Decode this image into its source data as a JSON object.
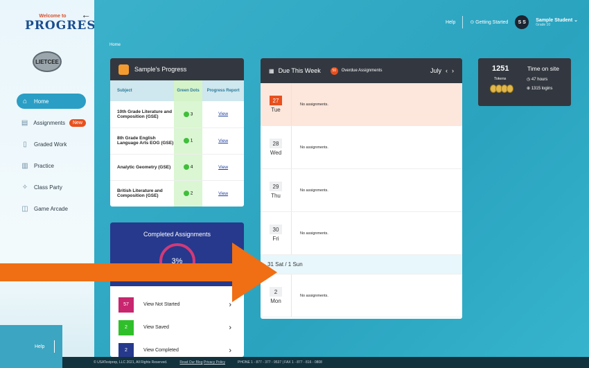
{
  "brand": {
    "welcome": "Welcome to",
    "name": "PROGRESS",
    "school": "LIETCEE"
  },
  "sidebar": {
    "items": [
      {
        "label": "Home",
        "icon": "home-icon"
      },
      {
        "label": "Assignments",
        "icon": "assignment-icon",
        "badge": "New"
      },
      {
        "label": "Graded Work",
        "icon": "document-icon"
      },
      {
        "label": "Practice",
        "icon": "practice-icon"
      },
      {
        "label": "Class Party",
        "icon": "party-icon"
      },
      {
        "label": "Game Arcade",
        "icon": "gamepad-icon"
      }
    ]
  },
  "header": {
    "help": "Help",
    "getting_started": "Getting Started",
    "user_initials": "S S",
    "user_name": "Sample Student",
    "grade": "Grade 10"
  },
  "breadcrumb": "Home",
  "progress": {
    "title": "Sample's Progress",
    "col_subject": "Subject",
    "col_dots": "Green Dots",
    "col_report": "Progress Report",
    "rows": [
      {
        "subject": "10th Grade Literature and Composition (GSE)",
        "dots": "3",
        "report": "View"
      },
      {
        "subject": "8th Grade English Language Arts EOG (GSE)",
        "dots": "1",
        "report": "View"
      },
      {
        "subject": "Analytic Geometry (GSE)",
        "dots": "4",
        "report": "View"
      },
      {
        "subject": "British Literature and Composition (GSE)",
        "dots": "2",
        "report": "View"
      }
    ]
  },
  "completed": {
    "title": "Completed Assignments",
    "percent": "3%",
    "rows": [
      {
        "count": "57",
        "label": "View Not Started",
        "color": "#c8266f"
      },
      {
        "count": "2",
        "label": "View Saved",
        "color": "#2fbf2a"
      },
      {
        "count": "2",
        "label": "View Completed",
        "color": "#26398c"
      }
    ]
  },
  "calendar": {
    "title": "Due This Week",
    "overdue_count": "50",
    "overdue_label": "Overdue Assignments",
    "month": "July",
    "days": [
      {
        "num": "27",
        "day": "Tue",
        "text": "No assignments."
      },
      {
        "num": "28",
        "day": "Wed",
        "text": "No assignments."
      },
      {
        "num": "29",
        "day": "Thu",
        "text": "No assignments."
      },
      {
        "num": "30",
        "day": "Fri",
        "text": "No assignments."
      },
      {
        "num": "2",
        "day": "Mon",
        "text": "No assignments."
      }
    ],
    "weekend": "31 Sat / 1 Sun"
  },
  "stats": {
    "tokens": "1251",
    "tokens_label": "Tokens",
    "time_title": "Time on site",
    "hours": "47 hours",
    "logins": "1315 logins"
  },
  "help_mini": "Help",
  "footer": {
    "copyright": "© USATestprep, LLC 2021, All Rights Reserved.",
    "blog": "Read Our Blog",
    "privacy": "Privacy Policy",
    "contact": "PHONE 1 - 877 - 377 - 9537 | FAX 1 - 877 - 816 - 0808"
  }
}
